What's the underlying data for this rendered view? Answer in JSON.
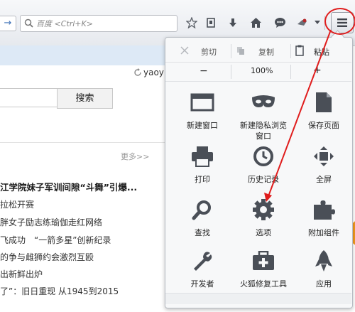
{
  "toolbar": {
    "back_glyph": "→",
    "search_placeholder": "百度 <Ctrl+K>"
  },
  "page": {
    "user_label": "yaoy",
    "search_button": "搜索",
    "more_link": "更多>>",
    "news": [
      "江学院妹子军训间隙“斗舞”引爆...",
      "拉松开赛",
      "胖女子励志练瑜伽走红网络",
      "飞成功　“一箭多星”创新纪录",
      "的争与雌狮约会激烈互殴",
      "出新鲜出炉",
      "了”：旧日重现 从1945到2015"
    ]
  },
  "menu": {
    "cut": "剪切",
    "copy": "复制",
    "paste": "粘贴",
    "zoom_out": "−",
    "zoom_level": "100%",
    "zoom_in": "+",
    "items": [
      {
        "label": "新建窗口",
        "icon": "new-window-icon"
      },
      {
        "label": "新建隐私浏览\n窗口",
        "icon": "private-window-icon"
      },
      {
        "label": "保存页面",
        "icon": "save-page-icon"
      },
      {
        "label": "打印",
        "icon": "print-icon"
      },
      {
        "label": "历史记录",
        "icon": "history-icon"
      },
      {
        "label": "全屏",
        "icon": "fullscreen-icon"
      },
      {
        "label": "查找",
        "icon": "find-icon"
      },
      {
        "label": "选项",
        "icon": "options-gear-icon"
      },
      {
        "label": "附加组件",
        "icon": "addons-puzzle-icon"
      },
      {
        "label": "开发者",
        "icon": "developer-wrench-icon"
      },
      {
        "label": "火狐修复工具",
        "icon": "repair-toolkit-icon"
      },
      {
        "label": "应用",
        "icon": "apps-rocket-icon"
      }
    ]
  },
  "colors": {
    "annotation": "#e01d1d",
    "accent": "#3b6fb6",
    "icon_dark": "#4a4f57"
  }
}
